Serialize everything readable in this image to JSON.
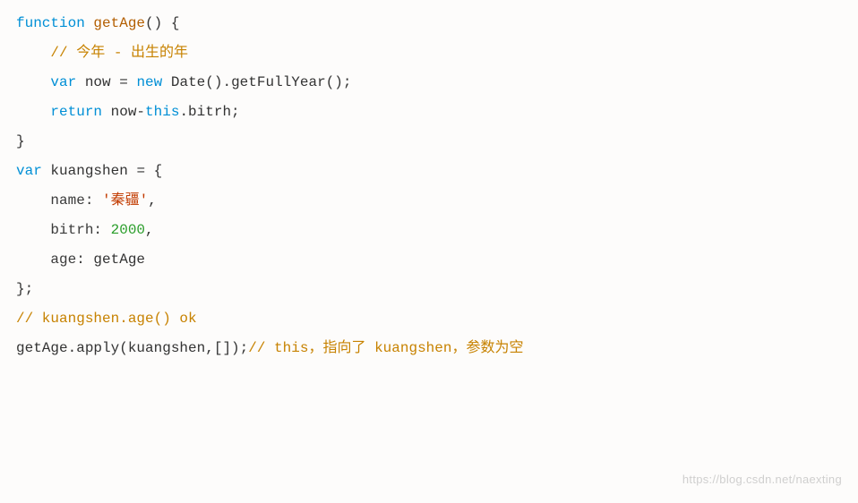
{
  "code": {
    "l1": {
      "kw1": "function",
      "name": "getAge",
      "rest": "() {"
    },
    "l2": {
      "comment": "// 今年 - 出生的年"
    },
    "l3": {
      "kw1": "var",
      "ident": "now",
      "eq": " = ",
      "kw2": "new",
      "call": " Date().getFullYear();"
    },
    "l4": {
      "kw1": "return",
      "ident": " now",
      "op": "-",
      "kw2": "this",
      "rest": ".bitrh;"
    },
    "l5": {
      "text": "}"
    },
    "l6": {
      "text": ""
    },
    "l7": {
      "kw1": "var",
      "ident": "kuangshen",
      "rest": " = {"
    },
    "l8": {
      "prop": "name",
      "sep": ": ",
      "val": "'秦疆'",
      "comma": ","
    },
    "l9": {
      "prop": "bitrh",
      "sep": ": ",
      "val": "2000",
      "comma": ","
    },
    "l10": {
      "prop": "age",
      "sep": ": ",
      "val": "getAge"
    },
    "l11": {
      "text": "};"
    },
    "l12": {
      "text": ""
    },
    "l13": {
      "comment": "// kuangshen.age() ok"
    },
    "l14": {
      "text": ""
    },
    "l15": {
      "call": "getAge.apply(kuangshen,[]);",
      "comment": "// this，指向了 kuangshen，参数为空"
    }
  },
  "watermark": "https://blog.csdn.net/naexting"
}
